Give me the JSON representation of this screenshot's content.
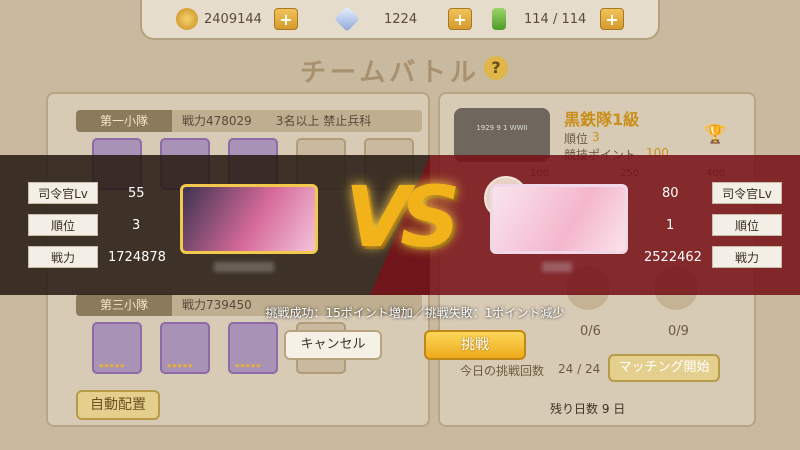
{
  "resources": {
    "coins": "2409144",
    "gems": "1224",
    "stamina": "114 / 114"
  },
  "header": {
    "title": "チームバトル",
    "help": "?"
  },
  "squads": [
    {
      "tag": "第一小隊",
      "info": "戦力478029　　3名以上 禁止兵科"
    },
    {
      "tag": "第三小隊",
      "info": "戦力739450"
    }
  ],
  "left_panel": {
    "auto_button": "自動配置"
  },
  "right_panel": {
    "rank_title": "黒鉄隊1級",
    "rank_label": "順位",
    "rank_value": "3",
    "points_label": "競技ポイント",
    "points_value": "100",
    "badge_text": "1929 9 1 WWII",
    "scale_ticks": [
      "100",
      "250",
      "400"
    ],
    "counts": [
      "0/6",
      "0/9"
    ],
    "today_label": "今日の挑戦回数",
    "today_value": "24 / 24",
    "matching_button": "マッチング開始",
    "days_left": "残り日数 9 日"
  },
  "versus": {
    "vs_text": "VS",
    "player": {
      "commander_label": "司令官Lv",
      "commander_level": "55",
      "rank_label": "順位",
      "rank": "3",
      "power_label": "戦力",
      "power": "1724878"
    },
    "opponent": {
      "commander_label": "司令官Lv",
      "commander_level": "80",
      "rank_label": "順位",
      "rank": "1",
      "power_label": "戦力",
      "power": "2522462"
    },
    "info_text": "挑戦成功：15ポイント増加／挑戦失敗：1ポイント減少",
    "cancel_label": "キャンセル",
    "challenge_label": "挑戦"
  },
  "colors": {
    "accent_gold": "#f2b21a",
    "left_banner": "#281c14",
    "right_banner": "#78121a"
  }
}
